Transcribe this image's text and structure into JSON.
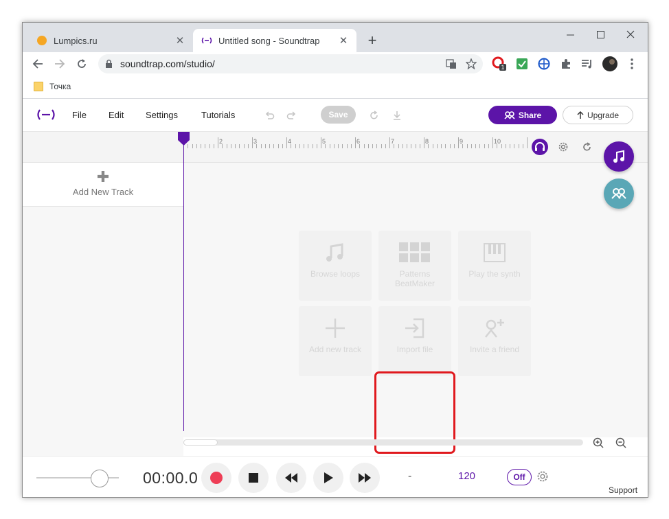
{
  "browser": {
    "tabs": [
      {
        "title": "Lumpics.ru",
        "active": false
      },
      {
        "title": "Untitled song - Soundtrap",
        "active": true
      }
    ],
    "url": "soundtrap.com/studio/",
    "bookmark": "Точка",
    "extension_badge": "1"
  },
  "studio": {
    "menu": [
      "File",
      "Edit",
      "Settings",
      "Tutorials"
    ],
    "save_label": "Save",
    "share_label": "Share",
    "upgrade_label": "Upgrade",
    "ruler_numbers": [
      "2",
      "3",
      "4",
      "5",
      "6",
      "7",
      "8",
      "9",
      "10"
    ],
    "add_track_label": "Add New Track",
    "tiles": [
      {
        "label": "Browse loops",
        "icon": "music-note-icon"
      },
      {
        "label": "Patterns BeatMaker",
        "icon": "patterns-grid-icon"
      },
      {
        "label": "Play the synth",
        "icon": "piano-keys-icon"
      },
      {
        "label": "Add new track",
        "icon": "plus-icon"
      },
      {
        "label": "Import file",
        "icon": "import-icon",
        "highlighted": true
      },
      {
        "label": "Invite a friend",
        "icon": "invite-friend-icon"
      }
    ],
    "transport": {
      "time": "00:00.0",
      "key": "-",
      "tempo": "120",
      "metronome": "Off"
    },
    "support_label": "Support"
  },
  "colors": {
    "accent": "#5c14a8",
    "fab_teal": "#5aa7b6",
    "record": "#ee3e56",
    "highlight": "#e0191e"
  }
}
